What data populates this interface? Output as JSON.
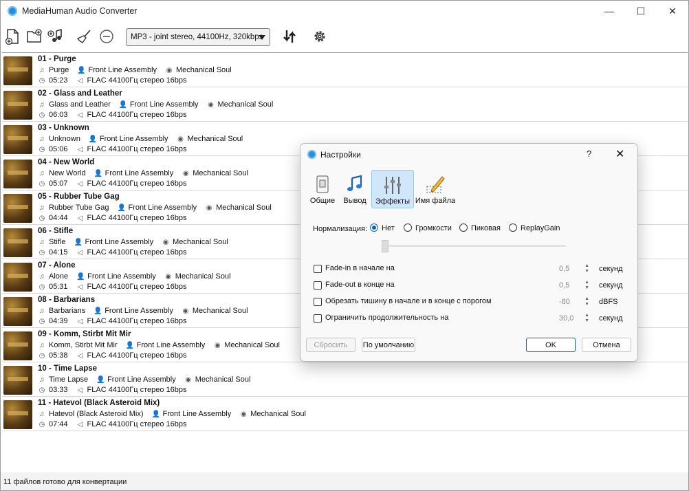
{
  "window": {
    "title": "MediaHuman Audio Converter"
  },
  "toolbar": {
    "format": "MP3 - joint stereo, 44100Hz, 320kbps"
  },
  "tracks": [
    {
      "title": "01 - Purge",
      "song": "Purge",
      "artist": "Front Line Assembly",
      "album": "Mechanical Soul",
      "duration": "05:23",
      "format": "FLAC 44100Гц стерео 16bps"
    },
    {
      "title": "02 - Glass and Leather",
      "song": "Glass and Leather",
      "artist": "Front Line Assembly",
      "album": "Mechanical Soul",
      "duration": "06:03",
      "format": "FLAC 44100Гц стерео 16bps"
    },
    {
      "title": "03 - Unknown",
      "song": "Unknown",
      "artist": "Front Line Assembly",
      "album": "Mechanical Soul",
      "duration": "05:06",
      "format": "FLAC 44100Гц стерео 16bps"
    },
    {
      "title": "04 - New World",
      "song": "New World",
      "artist": "Front Line Assembly",
      "album": "Mechanical Soul",
      "duration": "05:07",
      "format": "FLAC 44100Гц стерео 16bps"
    },
    {
      "title": "05 - Rubber Tube Gag",
      "song": "Rubber Tube Gag",
      "artist": "Front Line Assembly",
      "album": "Mechanical Soul",
      "duration": "04:44",
      "format": "FLAC 44100Гц стерео 16bps"
    },
    {
      "title": "06 - Stifle",
      "song": "Stifle",
      "artist": "Front Line Assembly",
      "album": "Mechanical Soul",
      "duration": "04:15",
      "format": "FLAC 44100Гц стерео 16bps"
    },
    {
      "title": "07 - Alone",
      "song": "Alone",
      "artist": "Front Line Assembly",
      "album": "Mechanical Soul",
      "duration": "05:31",
      "format": "FLAC 44100Гц стерео 16bps"
    },
    {
      "title": "08 - Barbarians",
      "song": "Barbarians",
      "artist": "Front Line Assembly",
      "album": "Mechanical Soul",
      "duration": "04:39",
      "format": "FLAC 44100Гц стерео 16bps"
    },
    {
      "title": "09 - Komm, Stirbt Mit Mir",
      "song": "Komm, Stirbt Mit Mir",
      "artist": "Front Line Assembly",
      "album": "Mechanical Soul",
      "duration": "05:38",
      "format": "FLAC 44100Гц стерео 16bps"
    },
    {
      "title": "10 - Time Lapse",
      "song": "Time Lapse",
      "artist": "Front Line Assembly",
      "album": "Mechanical Soul",
      "duration": "03:33",
      "format": "FLAC 44100Гц стерео 16bps"
    },
    {
      "title": "11 - Hatevol (Black Asteroid Mix)",
      "song": "Hatevol (Black Asteroid Mix)",
      "artist": "Front Line Assembly",
      "album": "Mechanical Soul",
      "duration": "07:44",
      "format": "FLAC 44100Гц стерео 16bps"
    }
  ],
  "status": {
    "text": "11 файлов готово для конвертации"
  },
  "dialog": {
    "title": "Настройки",
    "help": "?",
    "close": "✕",
    "tabs": [
      {
        "label": "Общие",
        "icon": "switch-icon"
      },
      {
        "label": "Вывод",
        "icon": "music-note-icon"
      },
      {
        "label": "Эффекты",
        "icon": "equalizer-icon"
      },
      {
        "label": "Имя файла",
        "icon": "pencil-icon"
      }
    ],
    "active_tab": "Эффекты",
    "normalization": {
      "label": "Нормализация:",
      "options": [
        "Нет",
        "Громкости",
        "Пиковая",
        "ReplayGain"
      ],
      "selected": "Нет"
    },
    "options": [
      {
        "label": "Fade-in в начале на",
        "value": "0,5",
        "unit": "секунд",
        "checked": false
      },
      {
        "label": "Fade-out в конце на",
        "value": "0,5",
        "unit": "секунд",
        "checked": false
      },
      {
        "label": "Обрезать тишину в начале и в конце с порогом",
        "value": "-80",
        "unit": "dBFS",
        "checked": false
      },
      {
        "label": "Ограничить продолжительность на",
        "value": "30,0",
        "unit": "секунд",
        "checked": false
      }
    ],
    "buttons": {
      "reset": "Сбросить",
      "defaults": "По умолчанию",
      "ok": "OK",
      "cancel": "Отмена"
    }
  },
  "colors": {
    "accent": "#0a60c0",
    "selected_tab": "#cfe6fb"
  }
}
